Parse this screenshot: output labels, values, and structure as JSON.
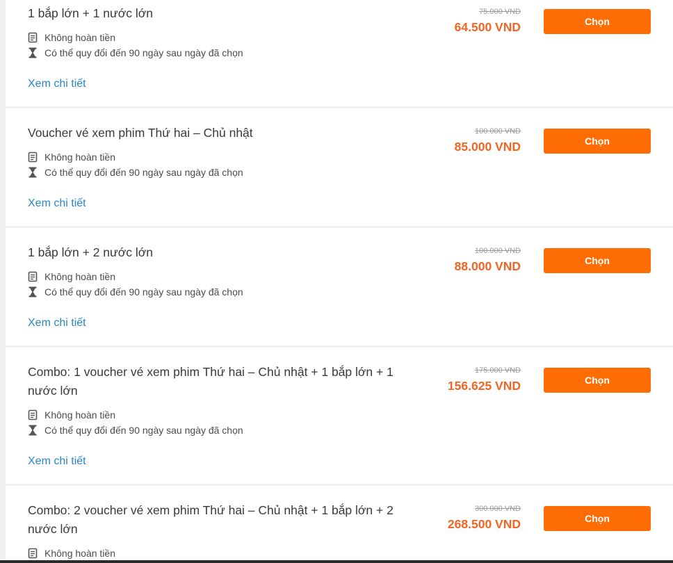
{
  "cards": [
    {
      "title": "1 bắp lớn + 1 nước lớn",
      "refund": "Không hoàn tiền",
      "validity": "Có thể quy đổi đến 90 ngày sau ngày đã chọn",
      "details_link": "Xem chi tiết",
      "old_price": "75.000 VND",
      "price": "64.500 VND",
      "button": "Chọn"
    },
    {
      "title": "Voucher vé xem phim Thứ hai – Chủ nhật",
      "refund": "Không hoàn tiền",
      "validity": "Có thể quy đổi đến 90 ngày sau ngày đã chọn",
      "details_link": "Xem chi tiết",
      "old_price": "100.000 VND",
      "price": "85.000 VND",
      "button": "Chọn"
    },
    {
      "title": "1 bắp lớn + 2 nước lớn",
      "refund": "Không hoàn tiền",
      "validity": "Có thể quy đổi đến 90 ngày sau ngày đã chọn",
      "details_link": "Xem chi tiết",
      "old_price": "100.000 VND",
      "price": "88.000 VND",
      "button": "Chọn"
    },
    {
      "title": "Combo: 1 voucher vé xem phim Thứ hai – Chủ nhật + 1 bắp lớn + 1 nước lớn",
      "refund": "Không hoàn tiền",
      "validity": "Có thể quy đổi đến 90 ngày sau ngày đã chọn",
      "details_link": "Xem chi tiết",
      "old_price": "175.000 VND",
      "price": "156.625 VND",
      "button": "Chọn"
    },
    {
      "title": "Combo: 2 voucher vé xem phim Thứ hai – Chủ nhật + 1 bắp lớn + 2 nước lớn",
      "refund": "Không hoàn tiền",
      "old_price": "300.000 VND",
      "price": "268.500 VND",
      "button": "Chọn"
    }
  ],
  "icons": {
    "refund": "receipt-icon",
    "validity": "hourglass-icon"
  },
  "colors": {
    "price": "#f26522",
    "button": "#ff6d04",
    "link": "#2a86c7"
  }
}
